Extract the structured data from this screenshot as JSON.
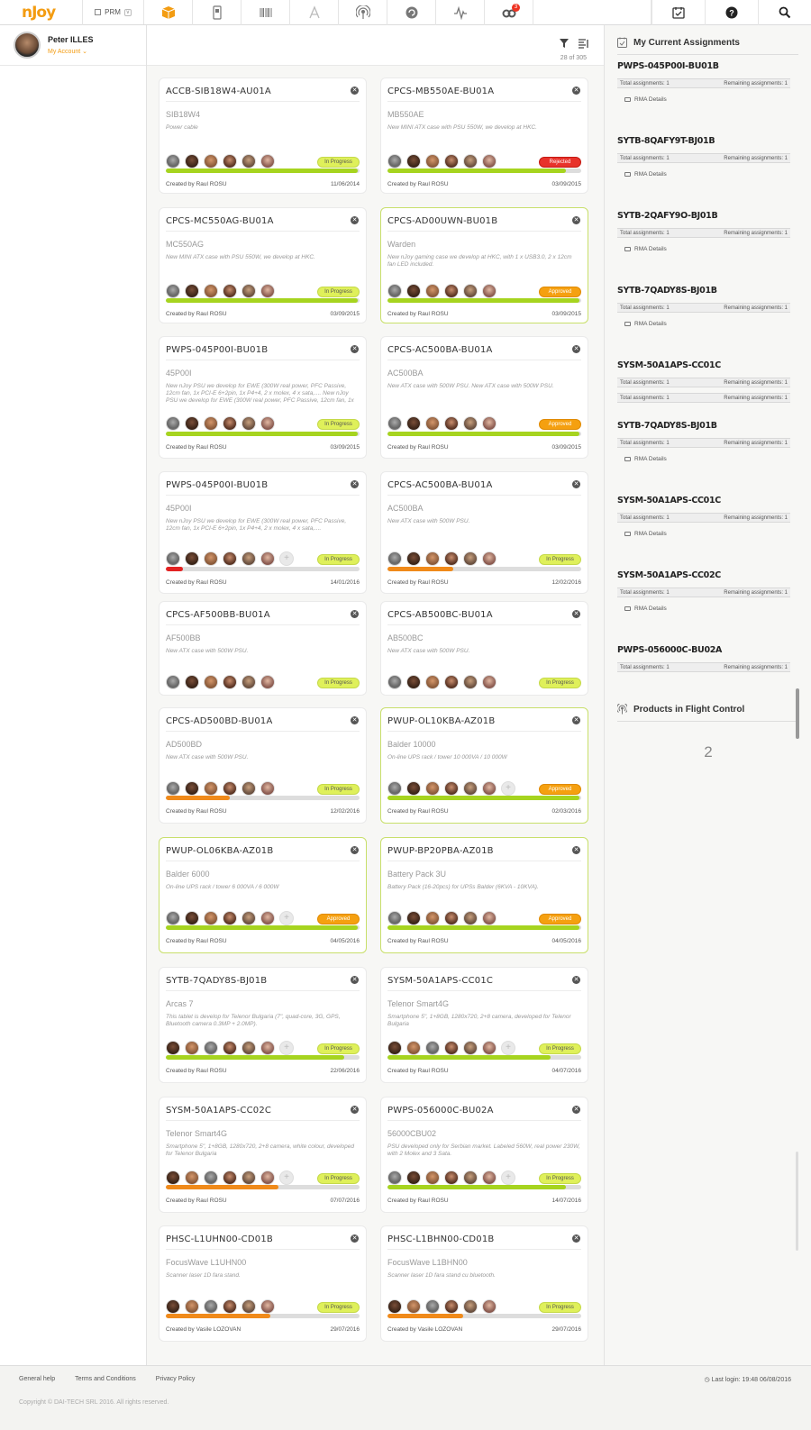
{
  "app": {
    "logo": "nJoy",
    "module": "PRM",
    "notification_count": "3"
  },
  "user": {
    "name": "Peter ILLES",
    "account_link": "My Account"
  },
  "list": {
    "count": "28 of 305"
  },
  "cards": [
    {
      "code": "ACCB-SIB18W4-AU01A",
      "model": "SIB18W4",
      "desc": "Power cable",
      "status": "In Progress",
      "progress": 0.99,
      "creator": "Created by Raul ROSU",
      "date": "11/06/2014"
    },
    {
      "code": "CPCS-MB550AE-BU01A",
      "model": "MB550AE",
      "desc": "New MINI ATX case with PSU 550W, we develop at HKC.",
      "status": "Rejected",
      "progress": 0.92,
      "creator": "Created by Raul ROSU",
      "date": "03/09/2015"
    },
    {
      "code": "CPCS-MC550AG-BU01A",
      "model": "MC550AG",
      "desc": "New MINI ATX case with PSU 550W, we develop at HKC.",
      "status": "In Progress",
      "progress": 0.99,
      "creator": "Created by Raul ROSU",
      "date": "03/09/2015"
    },
    {
      "code": "CPCS-AD00UWN-BU01B",
      "model": "Warden",
      "desc": "New nJoy gaming case we develop at HKC, with 1 x USB3.0, 2 x 12cm fan LED included.",
      "status": "Approved",
      "progress": 0.99,
      "creator": "Created by Raul ROSU",
      "date": "03/09/2015"
    },
    {
      "code": "PWPS-045P00I-BU01B",
      "model": "45P00I",
      "desc": "New nJoy PSU we develop for EWE (300W real power, PFC Passive, 12cm fan, 1x PCI-E 6+2pin, 1x P4+4, 2 x molex, 4 x sata,.... New nJoy PSU we develop for EWE (300W real power, PFC Passive, 12cm fan, 1x PCI-E 6+2pin, 1x P4+4, 2 x molex, 4 x sata,....",
      "status": "In Progress",
      "progress": 0.99,
      "creator": "Created by Raul ROSU",
      "date": "03/09/2015"
    },
    {
      "code": "CPCS-AC500BA-BU01A",
      "model": "AC500BA",
      "desc": "New ATX case with 500W PSU. New ATX case with 500W PSU.",
      "status": "Approved",
      "progress": 0.99,
      "creator": "Created by Raul ROSU",
      "date": "03/09/2015"
    },
    {
      "code": "PWPS-045P00I-BU01B",
      "model": "45P00I",
      "desc": "New nJoy PSU we develop for EWE (300W real power, PFC Passive, 12cm fan, 1x PCI-E 6+2pin, 1x P4+4, 2 x molex, 4 x sata,....",
      "status": "In Progress",
      "progress": 0.09,
      "creator": "Created by Raul ROSU",
      "date": "14/01/2016"
    },
    {
      "code": "CPCS-AC500BA-BU01A",
      "model": "AC500BA",
      "desc": "New ATX case with 500W PSU.",
      "status": "In Progress",
      "progress": 0.34,
      "creator": "Created by Raul ROSU",
      "date": "12/02/2016"
    },
    {
      "code": "CPCS-AF500BB-BU01A",
      "model": "AF500BB",
      "desc": "New ATX case with 500W PSU.",
      "status": "In Progress",
      "progress": null,
      "creator": "",
      "date": ""
    },
    {
      "code": "CPCS-AB500BC-BU01A",
      "model": "AB500BC",
      "desc": "New ATX case with 500W PSU.",
      "status": "In Progress",
      "progress": null,
      "creator": "",
      "date": ""
    },
    {
      "code": "CPCS-AD500BD-BU01A",
      "model": "AD500BD",
      "desc": "New ATX case with 500W PSU.",
      "status": "In Progress",
      "progress": 0.33,
      "creator": "Created by Raul ROSU",
      "date": "12/02/2016"
    },
    {
      "code": "PWUP-OL10KBA-AZ01B",
      "model": "Balder 10000",
      "desc": "On-line UPS rack / tower 10 000VA / 10 000W",
      "status": "Approved",
      "progress": 0.99,
      "creator": "Created by Raul ROSU",
      "date": "02/03/2016"
    },
    {
      "code": "PWUP-OL06KBA-AZ01B",
      "model": "Balder 6000",
      "desc": "On-line UPS rack / tower 6 000VA / 6 000W",
      "status": "Approved",
      "progress": 0.99,
      "creator": "Created by Raul ROSU",
      "date": "04/05/2016"
    },
    {
      "code": "PWUP-BP20PBA-AZ01B",
      "model": "Battery Pack 3U",
      "desc": "Battery Pack (16-20pcs) for UPSs Balder (6KVA - 10KVA).",
      "status": "Approved",
      "progress": 0.99,
      "creator": "Created by Raul ROSU",
      "date": "04/05/2016"
    },
    {
      "code": "SYTB-7QADY8S-BJ01B",
      "model": "Arcas 7",
      "desc": "This tablet is develop for Telenor Bulgaria (7\", quad-core, 3G, GPS, Bluetooth camera 0.3MP + 2.0MP).",
      "status": "In Progress",
      "progress": 0.92,
      "creator": "Created by Raul ROSU",
      "date": "22/06/2016"
    },
    {
      "code": "SYSM-50A1APS-CC01C",
      "model": "Telenor Smart4G",
      "desc": "Smartphone 5\", 1+8GB, 1280x720, 2+8 camera, developed for Telenor Bulgaria",
      "status": "In Progress",
      "progress": 0.84,
      "creator": "Created by Raul ROSU",
      "date": "04/07/2016"
    },
    {
      "code": "SYSM-50A1APS-CC02C",
      "model": "Telenor Smart4G",
      "desc": "Smartphone 5\", 1+8GB, 1280x720, 2+8 camera, white colour, developed for Telenor Bulgaria",
      "status": "In Progress",
      "progress": 0.58,
      "creator": "Created by Raul ROSU",
      "date": "07/07/2016"
    },
    {
      "code": "PWPS-056000C-BU02A",
      "model": "56000CBU02",
      "desc": "PSU developed only for Serbian market. Labeled 560W, real power 230W, with 2 Molex and 3 Sata.",
      "status": "In Progress",
      "progress": 0.92,
      "creator": "Created by Raul ROSU",
      "date": "14/07/2016"
    },
    {
      "code": "PHSC-L1UHN00-CD01B",
      "model": "FocusWave L1UHN00",
      "desc": "Scanner laser 1D fara stand.",
      "status": "In Progress",
      "progress": 0.54,
      "creator": "Created by Vasile LOZOVAN",
      "date": "29/07/2016"
    },
    {
      "code": "PHSC-L1BHN00-CD01B",
      "model": "FocusWave L1BHN00",
      "desc": "Scanner laser 1D fara stand cu bluetooth.",
      "status": "In Progress",
      "progress": 0.39,
      "creator": "Created by Vasile LOZOVAN",
      "date": "29/07/2016"
    }
  ],
  "assignments": {
    "title": "My Current Assignments",
    "total_label": "Total assignments: 1",
    "remaining_label": "Remaining assignments: 1",
    "rma_label": "RMA Details",
    "items": [
      {
        "code": "PWPS-045P00I-BU01B"
      },
      {
        "code": "SYTB-8QAFY9T-BJ01B"
      },
      {
        "code": "SYTB-2QAFY9O-BJ01B"
      },
      {
        "code": "SYTB-7QADY8S-BJ01B"
      },
      {
        "code": "SYSM-50A1APS-CC01C"
      },
      {
        "code": "SYTB-7QADY8S-BJ01B"
      },
      {
        "code": "SYSM-50A1APS-CC01C"
      },
      {
        "code": "SYSM-50A1APS-CC02C"
      },
      {
        "code": "PWPS-056000C-BU02A"
      }
    ]
  },
  "flight": {
    "title": "Products in Flight Control",
    "count": "2"
  },
  "footer": {
    "links": [
      "General help",
      "Terms and Conditions",
      "Privacy Policy"
    ],
    "last_login": "Last login: 19:48 06/08/2016",
    "copyright": "Copyright © DAI-TECH SRL 2016. All rights reserved."
  },
  "colors": {
    "accent": "#f39c12",
    "progress_green": "#a6d41f",
    "progress_orange": "#f08a1a",
    "progress_red": "#e32222",
    "in_progress": "#dff05a",
    "approved": "#f5a010",
    "rejected": "#e8322b"
  }
}
